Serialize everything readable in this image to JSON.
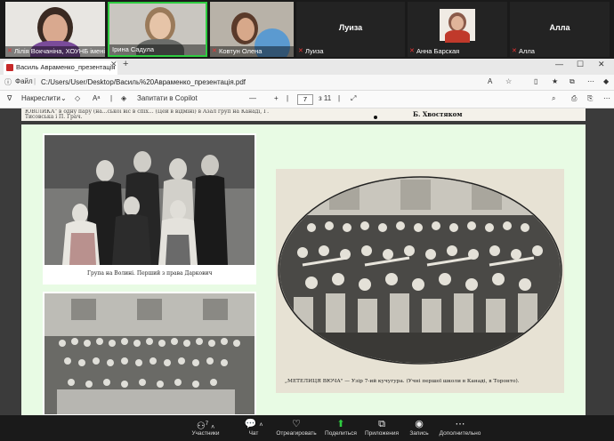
{
  "participants": [
    {
      "name": "Лілія Вокчаніна, ХОУНБ імені Олес...",
      "muted": true
    },
    {
      "name": "Ірина Садула",
      "muted": false,
      "active": true
    },
    {
      "name": "Ковтун Олена",
      "muted": true
    },
    {
      "name": "Луиза",
      "big": "Луиза",
      "muted": true
    },
    {
      "name": "Анна Барская",
      "muted": true
    },
    {
      "name": "Алла",
      "big": "Алла",
      "muted": true
    }
  ],
  "browser": {
    "tab_title": "Василь Авраменко_презентація",
    "close": "✕",
    "new_tab": "+",
    "file_label": "Файл",
    "url": "C:/Users/User/Desktop/Василь%20Авраменко_презентація.pdf",
    "pdf_toolbar": {
      "draw": "Накреслити",
      "ask_copilot": "Запитати в Copilot",
      "zoom_out": "—",
      "zoom_in": "+",
      "page_current": "7",
      "page_total": "з 11"
    }
  },
  "document": {
    "prev_page_left": "ЮВІЛИКА\" в одну пару (на...ської віс в спіх... (Цей в відміні) в Азал груп на Канаді, Г. Тисовська і П. Грач.",
    "prev_page_right": "Б. Хвостяком",
    "caption_top_left": "Група на Волині. Перший з права Даркович",
    "caption_right": "„МЕТЕЛИЦЯ ВЮЧА\" — Узір 7-ий кучугура. (Учні першої школи в Канаді, в Торонто)."
  },
  "zoom_toolbar": [
    {
      "label": "Участники",
      "count": "7",
      "icon": "participants-icon"
    },
    {
      "label": "Чат",
      "icon": "chat-icon"
    },
    {
      "label": "Отреагировать",
      "icon": "react-icon"
    },
    {
      "label": "Поделиться",
      "icon": "share-icon"
    },
    {
      "label": "Приложения",
      "icon": "apps-icon"
    },
    {
      "label": "Запись",
      "icon": "record-icon"
    },
    {
      "label": "Дополнительно",
      "icon": "more-icon"
    }
  ]
}
